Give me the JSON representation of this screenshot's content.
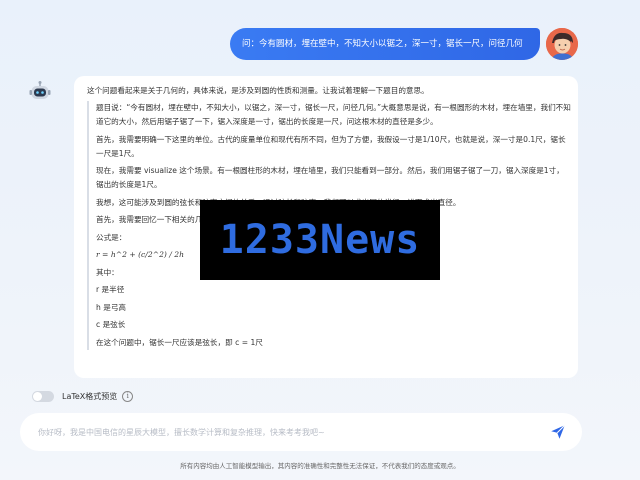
{
  "user_message": {
    "text": "问：今有圆材，埋在壁中，不知大小以锯之，深一寸，锯长一尺，问径几何"
  },
  "answer": {
    "intro": "这个问题看起来是关于几何的，具体来说，是涉及到圆的性质和测量。让我试着理解一下题目的意思。",
    "paragraphs": [
      "题目说：“今有圆材，埋在壁中，不知大小，以锯之，深一寸，锯长一尺，问径几何。”大概意思是说，有一根圆形的木材，埋在墙里，我们不知道它的大小，然后用锯子锯了一下，锯入深度是一寸，锯出的长度是一尺，问这根木材的直径是多少。",
      "首先，我需要明确一下这里的单位。古代的度量单位和现代有所不同，但为了方便，我假设一寸是1/10尺，也就是说，深一寸是0.1尺，锯长一尺是1尺。",
      "现在，我需要 visualize 这个场景。有一根圆柱形的木材，埋在墙里，我们只能看到一部分。然后，我们用锯子锯了一刀，锯入深度是1寸，锯出的长度是1尺。",
      "我想，这可能涉及到圆的弦长和弦高之间的关系，通过弦长和弦高，我们可以求出圆的半径，进而求出直径。",
      "首先，我需要回忆一下相关的几何公式。",
      "公式是：",
      "r = h^2 + (c/2^2) / 2h",
      "其中：",
      "r 是半径",
      "h 是弓高",
      "c 是弦长",
      "在这个问题中，锯长一尺应该是弦长，即 c = 1尺"
    ]
  },
  "watermark": {
    "text": "1233News",
    "color": "#2f6ce0"
  },
  "latex_toggle": {
    "label": "LaTeX格式预览",
    "info": "i",
    "on": false
  },
  "input": {
    "placeholder": "你好呀，我是中国电信的星辰大模型，擅长数学计算和复杂推理，快来考考我吧~",
    "value": ""
  },
  "send_icon": "paper-plane-icon",
  "footer": {
    "text": "所有内容均由人工智能模型输出，其内容的准确性和完整性无法保证，不代表我们的态度或观点。"
  },
  "colors": {
    "accent": "#2f67e6",
    "background": "#eaf1fb",
    "card": "#ffffff"
  }
}
